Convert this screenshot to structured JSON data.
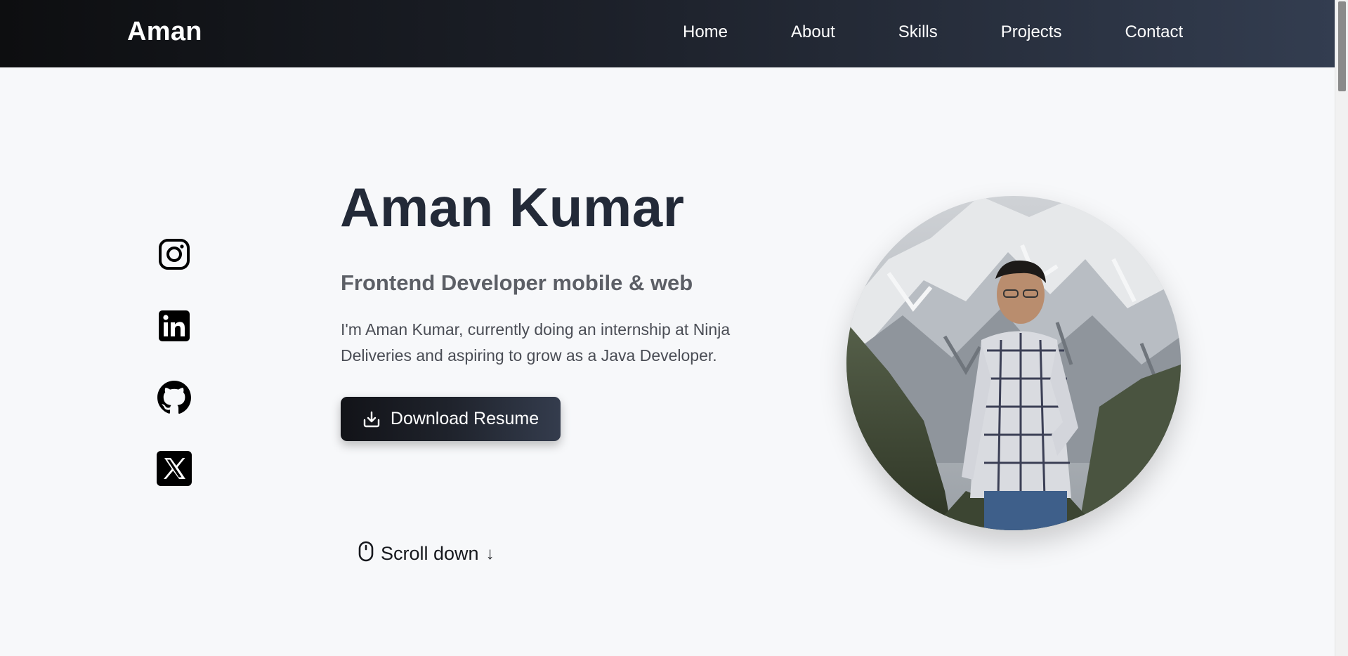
{
  "header": {
    "brand": "Aman",
    "nav": [
      "Home",
      "About",
      "Skills",
      "Projects",
      "Contact"
    ]
  },
  "social": [
    {
      "name": "instagram-icon"
    },
    {
      "name": "linkedin-icon"
    },
    {
      "name": "github-icon"
    },
    {
      "name": "x-icon"
    }
  ],
  "hero": {
    "title": "Aman Kumar",
    "subtitle": "Frontend Developer mobile & web",
    "description": "I'm Aman Kumar, currently doing an internship at Ninja Deliveries and aspiring to grow as a Java Developer.",
    "resume_button": "Download Resume",
    "scroll_label": "Scroll down",
    "scroll_arrow": "↓"
  },
  "colors": {
    "primary_text": "#232a38",
    "nav_gradient_start": "#0d0e10",
    "nav_gradient_end": "#333d50",
    "background": "#f7f8fa"
  }
}
